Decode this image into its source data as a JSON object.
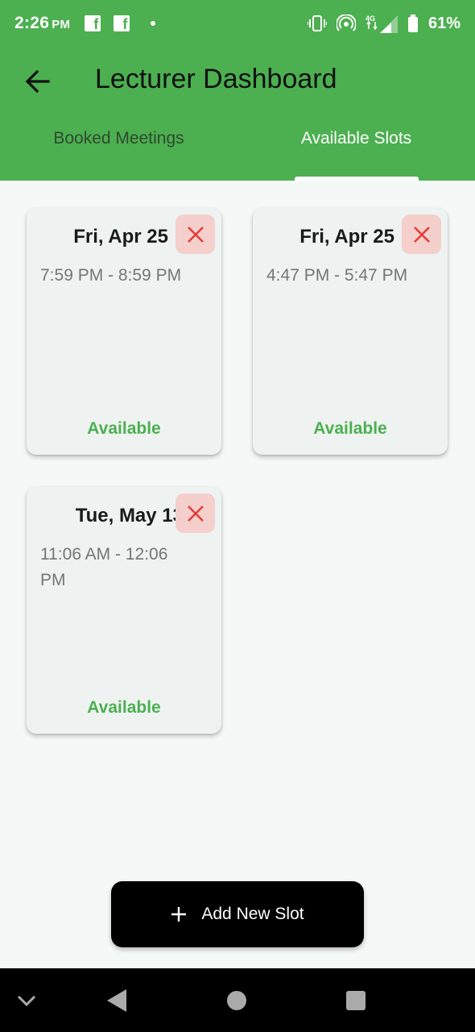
{
  "status_bar": {
    "time": "2:26",
    "ampm": "PM",
    "notification_icons": [
      "facebook-icon",
      "facebook-icon",
      "dot-icon"
    ],
    "battery": "61%"
  },
  "app_bar": {
    "title": "Lecturer Dashboard",
    "background": "#4caf50"
  },
  "tabs": [
    {
      "label": "Booked Meetings",
      "selected": false
    },
    {
      "label": "Available Slots",
      "selected": true
    }
  ],
  "slots": [
    {
      "date": "Fri, Apr 25",
      "time": "7:59 PM - 8:59 PM",
      "status": "Available"
    },
    {
      "date": "Fri, Apr 25",
      "time": "4:47 PM - 5:47 PM",
      "status": "Available"
    },
    {
      "date": "Tue, May 13",
      "time": "11:06 AM - 12:06 PM",
      "status": "Available"
    }
  ],
  "fab": {
    "label": "Add New Slot",
    "icon": "plus-icon"
  },
  "colors": {
    "accent": "#4caf50",
    "delete_bg": "#f4cfcb",
    "delete_icon": "#e53935"
  }
}
